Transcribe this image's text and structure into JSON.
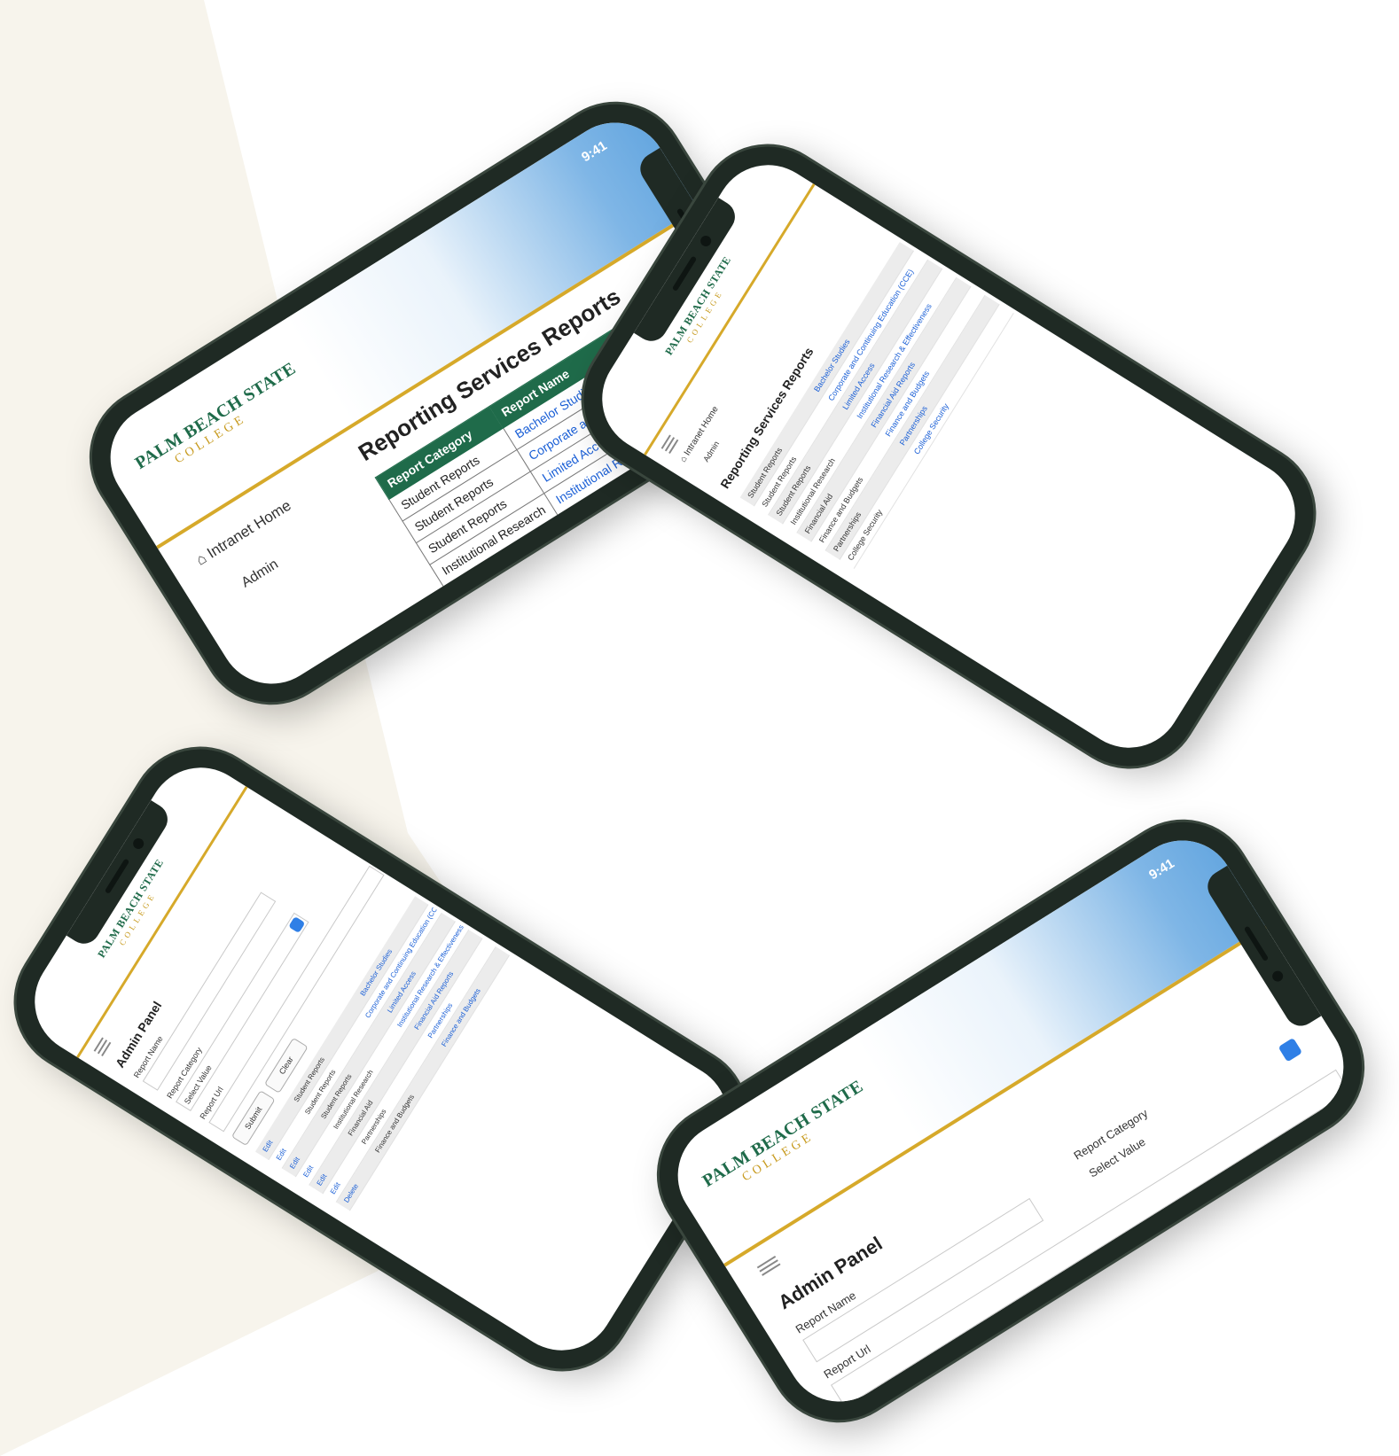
{
  "status_bar": {
    "time": "9:41"
  },
  "logo": {
    "line1": "PALM BEACH STATE",
    "line2": "COLLEGE"
  },
  "nav": {
    "home": "Intranet Home",
    "admin": "Admin"
  },
  "reports_page": {
    "title": "Reporting Services Reports",
    "columns": [
      "Report Category",
      "Report Name"
    ],
    "rows": [
      {
        "category": "Student Reports",
        "name": "Bachelor Studies"
      },
      {
        "category": "Student Reports",
        "name": "Corporate and Continuing Education (CCE)"
      },
      {
        "category": "Student Reports",
        "name": "Limited Access"
      },
      {
        "category": "Institutional Research",
        "name": "Institutional Research & Effectiveness"
      },
      {
        "category": "Financial Aid",
        "name": "Financial Aid Reports"
      }
    ]
  },
  "reports_list_compact": {
    "rows": [
      {
        "category": "Student Reports",
        "name": "Bachelor Studies"
      },
      {
        "category": "Student Reports",
        "name": "Corporate and Continuing Education (CCE)"
      },
      {
        "category": "Student Reports",
        "name": "Limited Access"
      },
      {
        "category": "Institutional Research",
        "name": "Institutional Research & Effectiveness"
      },
      {
        "category": "Financial Aid",
        "name": "Financial Aid Reports"
      },
      {
        "category": "Finance and Budgets",
        "name": "Finance and Budgets"
      },
      {
        "category": "Partnerships",
        "name": "Partnerships"
      },
      {
        "category": "College Security",
        "name": "College Security"
      }
    ]
  },
  "admin_panel": {
    "title": "Admin Panel",
    "report_name_label": "Report Name",
    "report_category_label": "Report Category",
    "select_placeholder": "Select Value",
    "report_url_label": "Report Url",
    "submit_label": "Submit",
    "clear_label": "Clear",
    "list_actions": [
      "Edit",
      "Delete"
    ],
    "list_rows": [
      {
        "category": "Student Reports",
        "name": "Bachelor Studies"
      },
      {
        "category": "Student Reports",
        "name": "Corporate and Continuing Education (CCE)"
      },
      {
        "category": "Student Reports",
        "name": "Limited Access"
      },
      {
        "category": "Institutional Research",
        "name": "Institutional Research & Effectiveness"
      },
      {
        "category": "Financial Aid",
        "name": "Financial Aid Reports"
      },
      {
        "category": "Partnerships",
        "name": "Partnerships"
      },
      {
        "category": "Finance and Budgets",
        "name": "Finance and Budgets"
      }
    ]
  },
  "colors": {
    "brand_green": "#1f6b4a",
    "brand_gold": "#d6a92a",
    "link_blue": "#1a5fd6",
    "sky_blue": "#5aa0dd"
  }
}
